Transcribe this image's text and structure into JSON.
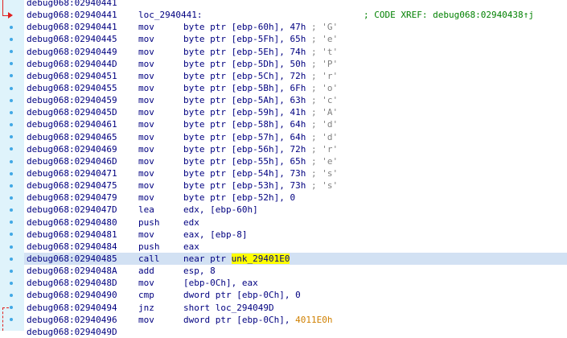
{
  "colors": {
    "gutter_bg": "#dff3fb",
    "gutter_dot": "#41a8e6",
    "arrow": "#e02020",
    "highlight_row": "#d2e1f3",
    "cursor_symbol": "#ffff00",
    "text": "#000080",
    "comment": "#808080",
    "xref": "#008000",
    "immediate_address": "#d08000"
  },
  "rows": [
    {
      "addr": "debug068:02940441"
    },
    {
      "addr": "debug068:02940441",
      "label": "loc_2940441:",
      "xref": "; CODE XREF: debug068:02940438↑j"
    },
    {
      "addr": "debug068:02940441",
      "mn": "mov",
      "op": "byte ptr [ebp-60h], 47h",
      "cmt": " ; 'G'"
    },
    {
      "addr": "debug068:02940445",
      "mn": "mov",
      "op": "byte ptr [ebp-5Fh], 65h",
      "cmt": " ; 'e'"
    },
    {
      "addr": "debug068:02940449",
      "mn": "mov",
      "op": "byte ptr [ebp-5Eh], 74h",
      "cmt": " ; 't'"
    },
    {
      "addr": "debug068:0294044D",
      "mn": "mov",
      "op": "byte ptr [ebp-5Dh], 50h",
      "cmt": " ; 'P'"
    },
    {
      "addr": "debug068:02940451",
      "mn": "mov",
      "op": "byte ptr [ebp-5Ch], 72h",
      "cmt": " ; 'r'"
    },
    {
      "addr": "debug068:02940455",
      "mn": "mov",
      "op": "byte ptr [ebp-5Bh], 6Fh",
      "cmt": " ; 'o'"
    },
    {
      "addr": "debug068:02940459",
      "mn": "mov",
      "op": "byte ptr [ebp-5Ah], 63h",
      "cmt": " ; 'c'"
    },
    {
      "addr": "debug068:0294045D",
      "mn": "mov",
      "op": "byte ptr [ebp-59h], 41h",
      "cmt": " ; 'A'"
    },
    {
      "addr": "debug068:02940461",
      "mn": "mov",
      "op": "byte ptr [ebp-58h], 64h",
      "cmt": " ; 'd'"
    },
    {
      "addr": "debug068:02940465",
      "mn": "mov",
      "op": "byte ptr [ebp-57h], 64h",
      "cmt": " ; 'd'"
    },
    {
      "addr": "debug068:02940469",
      "mn": "mov",
      "op": "byte ptr [ebp-56h], 72h",
      "cmt": " ; 'r'"
    },
    {
      "addr": "debug068:0294046D",
      "mn": "mov",
      "op": "byte ptr [ebp-55h], 65h",
      "cmt": " ; 'e'"
    },
    {
      "addr": "debug068:02940471",
      "mn": "mov",
      "op": "byte ptr [ebp-54h], 73h",
      "cmt": " ; 's'"
    },
    {
      "addr": "debug068:02940475",
      "mn": "mov",
      "op": "byte ptr [ebp-53h], 73h",
      "cmt": " ; 's'"
    },
    {
      "addr": "debug068:02940479",
      "mn": "mov",
      "op": "byte ptr [ebp-52h], 0"
    },
    {
      "addr": "debug068:0294047D",
      "mn": "lea",
      "op": "edx, [ebp-60h]"
    },
    {
      "addr": "debug068:02940480",
      "mn": "push",
      "op": "edx"
    },
    {
      "addr": "debug068:02940481",
      "mn": "mov",
      "op": "eax, [ebp-8]"
    },
    {
      "addr": "debug068:02940484",
      "mn": "push",
      "op": "eax"
    },
    {
      "addr": "debug068:02940485",
      "mn": "call",
      "op": "near ptr ",
      "sym": "unk_29401E0",
      "highlight": true
    },
    {
      "addr": "debug068:0294048A",
      "mn": "add",
      "op": "esp, 8"
    },
    {
      "addr": "debug068:0294048D",
      "mn": "mov",
      "op": "[ebp-0Ch], eax"
    },
    {
      "addr": "debug068:02940490",
      "mn": "cmp",
      "op": "dword ptr [ebp-0Ch], 0"
    },
    {
      "addr": "debug068:02940494",
      "mn": "jnz",
      "op": "short loc_294049D"
    },
    {
      "addr": "debug068:02940496",
      "mn": "mov",
      "op": "dword ptr [ebp-0Ch], ",
      "op_orange": "4011E0h"
    },
    {
      "addr": "debug068:0294049D"
    }
  ]
}
